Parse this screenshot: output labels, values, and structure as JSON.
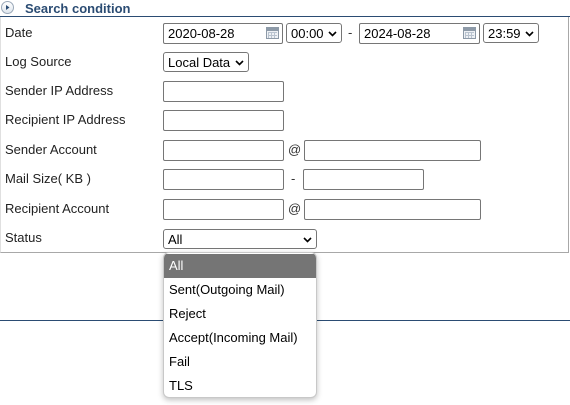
{
  "header": {
    "title": "Search condition",
    "icon": "expand-icon"
  },
  "labels": {
    "date": "Date",
    "log_source": "Log Source",
    "sender_ip": "Sender IP Address",
    "recipient_ip": "Recipient IP Address",
    "sender_account": "Sender Account",
    "mail_size": "Mail Size( KB )",
    "recipient_account": "Recipient Account",
    "status": "Status"
  },
  "date_range": {
    "start_date": "2020-08-28",
    "start_time": "00:00",
    "separator": "-",
    "end_date": "2024-08-28",
    "end_time": "23:59"
  },
  "log_source": {
    "selected": "Local Data"
  },
  "sender_ip": {
    "value": ""
  },
  "recipient_ip": {
    "value": ""
  },
  "sender_account": {
    "user": "",
    "at": "@",
    "domain": ""
  },
  "mail_size": {
    "min": "",
    "separator": "-",
    "max": ""
  },
  "recipient_account": {
    "user": "",
    "at": "@",
    "domain": ""
  },
  "status": {
    "selected": "All",
    "options": [
      "All",
      "Sent(Outgoing Mail)",
      "Reject",
      "Accept(Incoming Mail)",
      "Fail",
      "TLS"
    ]
  },
  "colors": {
    "header_text": "#2b4c73",
    "selected_option_bg": "#757575"
  }
}
